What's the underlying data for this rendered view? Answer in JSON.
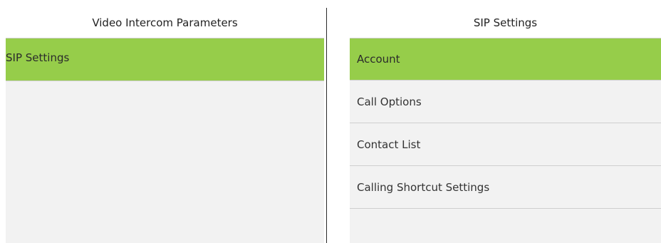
{
  "left_panel": {
    "title": "Video Intercom Parameters",
    "items": [
      {
        "label": "SIP Settings",
        "selected": true
      }
    ]
  },
  "right_panel": {
    "title": "SIP Settings",
    "items": [
      {
        "label": "Account",
        "selected": true
      },
      {
        "label": "Call Options",
        "selected": false
      },
      {
        "label": "Contact List",
        "selected": false
      },
      {
        "label": "Calling Shortcut Settings",
        "selected": false
      }
    ]
  },
  "colors": {
    "selected_bg": "#96cd4a",
    "panel_bg": "#f2f2f2",
    "divider": "#2a2a2a"
  }
}
